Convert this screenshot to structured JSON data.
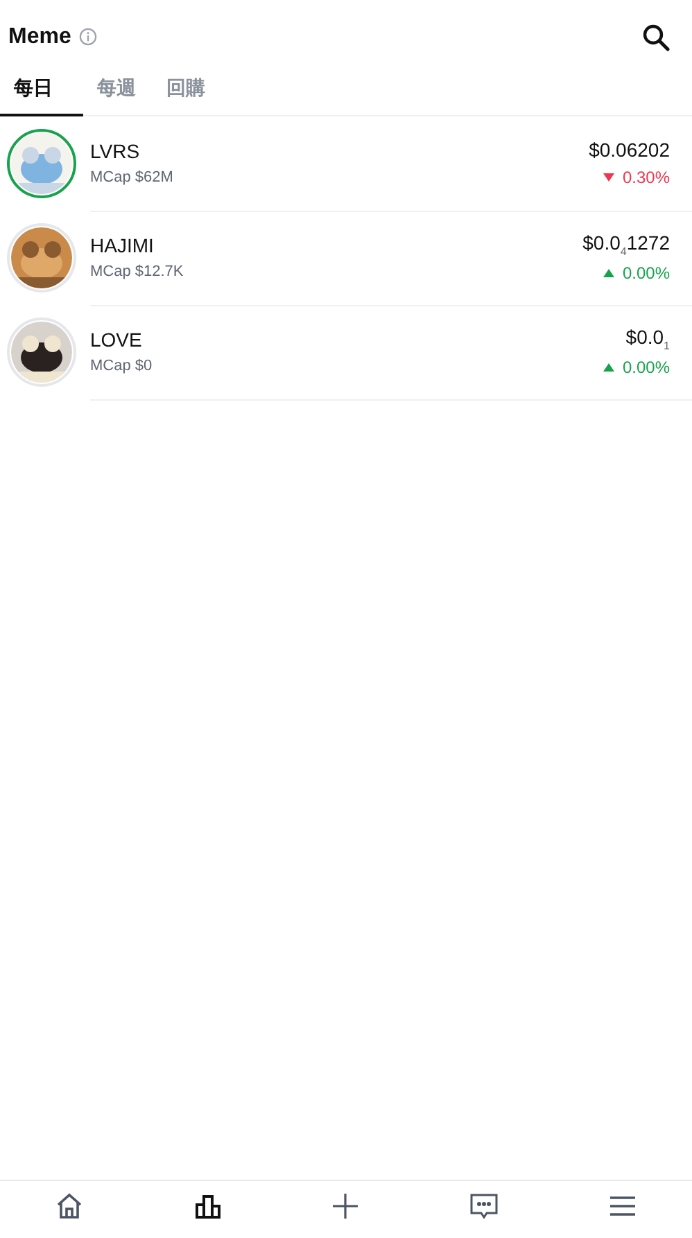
{
  "header": {
    "title": "Meme"
  },
  "tabs": [
    {
      "label": "每日",
      "selected": true
    },
    {
      "label": "每週",
      "selected": false
    },
    {
      "label": "回購",
      "selected": false
    }
  ],
  "coins": [
    {
      "symbol": "LVRS",
      "mcap": "MCap $62M",
      "price": "$0.06202",
      "change": "0.30%",
      "kind": "down",
      "color": "#16a34a"
    },
    {
      "symbol": "HAJIMI",
      "mcap": "MCap $12.7K",
      "price": "$0.0$_{4}$1272",
      "change": "0.00%",
      "kind": "up",
      "color": "#e5e7eb"
    },
    {
      "symbol": "LOVE",
      "mcap": "MCap $0",
      "price": "$0.0$_{1}$",
      "change": "0.00%",
      "kind": "up",
      "color": "#e5e7eb"
    }
  ],
  "nav": [
    {
      "kind": "home",
      "selected": false
    },
    {
      "kind": "market",
      "selected": true
    },
    {
      "kind": "create",
      "selected": false
    },
    {
      "kind": "inbox",
      "selected": false
    },
    {
      "kind": "menu",
      "selected": false
    }
  ]
}
